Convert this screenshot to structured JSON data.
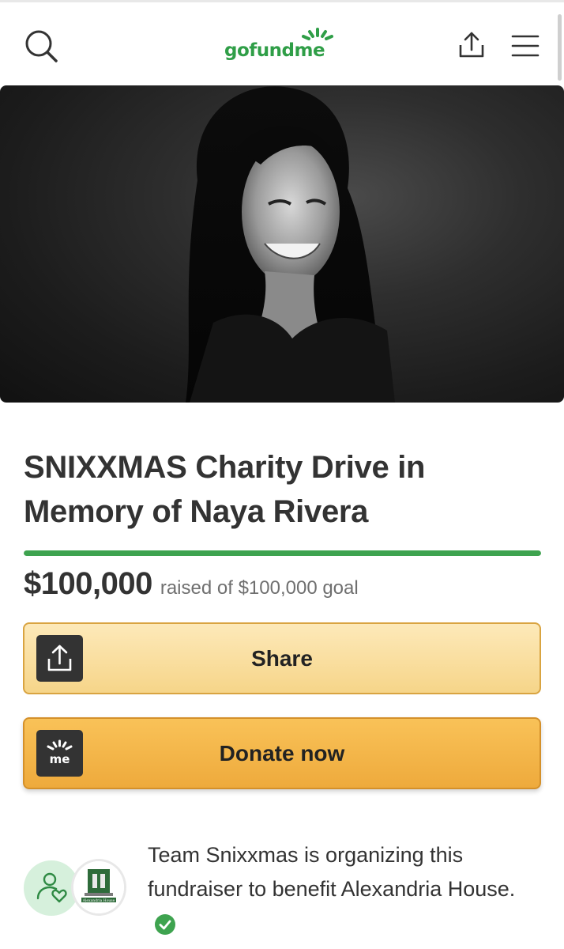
{
  "header": {
    "logo_text": "gofundme",
    "icons": {
      "search": "search-icon",
      "share": "share-icon",
      "menu": "hamburger-menu-icon"
    }
  },
  "hero": {
    "image": "campaign-photo"
  },
  "campaign": {
    "title": "SNIXXMAS Charity Drive in Memory of Naya Rivera",
    "progress": 1.0,
    "raised_amount": "$100,000",
    "raised_text": "raised of $100,000 goal"
  },
  "buttons": {
    "share_label": "Share",
    "donate_label": "Donate now",
    "donate_icon_text": "me"
  },
  "organizer": {
    "text": "Team Snixxmas is organizing this fundraiser to benefit Alexandria House.",
    "logo_text": "Alexandria House"
  },
  "colors": {
    "brand_green": "#2f9e47",
    "progress_green": "#3ea34f",
    "share_button": "#f8dda0",
    "donate_button": "#f3b549"
  }
}
